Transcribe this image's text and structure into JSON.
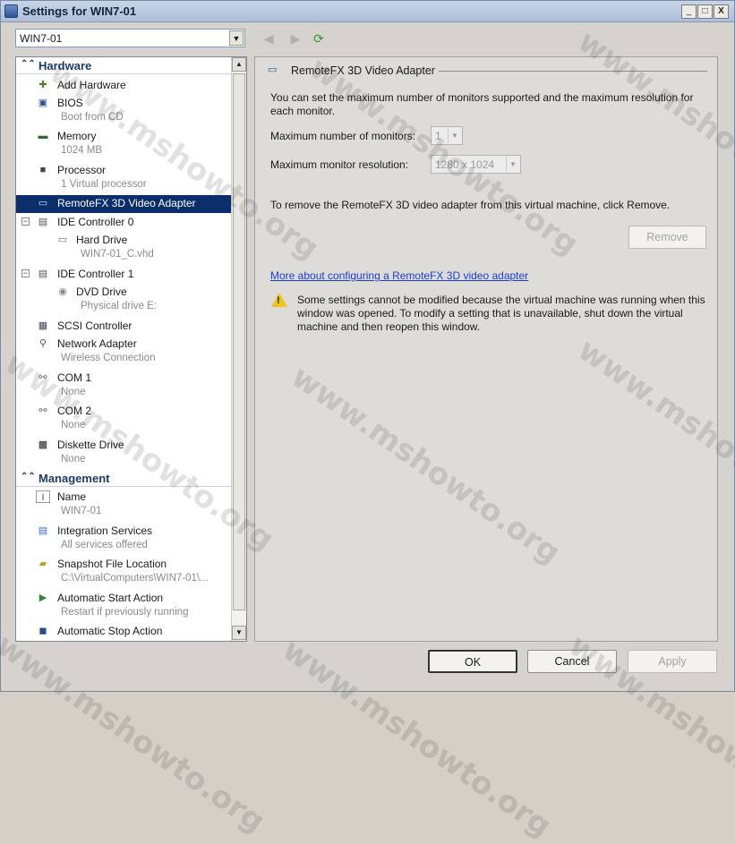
{
  "window": {
    "title": "Settings for WIN7-01",
    "minimize": "_",
    "restore": "□",
    "close": "X"
  },
  "vm_selector": {
    "value": "WIN7-01"
  },
  "hardware_section": {
    "label": "Hardware"
  },
  "management_section": {
    "label": "Management"
  },
  "hardware": {
    "add_hardware": "Add Hardware",
    "bios": {
      "label": "BIOS",
      "sub": "Boot from CD"
    },
    "memory": {
      "label": "Memory",
      "sub": "1024 MB"
    },
    "processor": {
      "label": "Processor",
      "sub": "1 Virtual processor"
    },
    "remotefx": {
      "label": "RemoteFX 3D Video Adapter"
    },
    "ide0": {
      "label": "IDE Controller 0"
    },
    "hard_drive": {
      "label": "Hard Drive",
      "sub": "WIN7-01_C.vhd"
    },
    "ide1": {
      "label": "IDE Controller 1"
    },
    "dvd_drive": {
      "label": "DVD Drive",
      "sub": "Physical drive E:"
    },
    "scsi": {
      "label": "SCSI Controller"
    },
    "network": {
      "label": "Network Adapter",
      "sub": "Wireless Connection"
    },
    "com1": {
      "label": "COM 1",
      "sub": "None"
    },
    "com2": {
      "label": "COM 2",
      "sub": "None"
    },
    "diskette": {
      "label": "Diskette Drive",
      "sub": "None"
    }
  },
  "management": {
    "name": {
      "label": "Name",
      "sub": "WIN7-01"
    },
    "integration": {
      "label": "Integration Services",
      "sub": "All services offered"
    },
    "snapshot": {
      "label": "Snapshot File Location",
      "sub": "C:\\VirtualComputers\\WIN7-01\\..."
    },
    "auto_start": {
      "label": "Automatic Start Action",
      "sub": "Restart if previously running"
    },
    "auto_stop": {
      "label": "Automatic Stop Action"
    }
  },
  "detail": {
    "group_title": "RemoteFX 3D Video Adapter",
    "description": "You can set the maximum number of monitors supported and the maximum resolution for each monitor.",
    "monitors_label": "Maximum number of monitors:",
    "monitors_value": "1",
    "resolution_label": "Maximum monitor resolution:",
    "resolution_value": "1280 x 1024",
    "remove_text": "To remove the RemoteFX 3D video adapter from this virtual machine, click Remove.",
    "remove_button": "Remove",
    "more_link": "More about configuring a RemoteFX 3D video adapter",
    "warning": "Some settings cannot be modified because the virtual machine was running when this window was opened. To modify a setting that is unavailable, shut down the virtual machine and then reopen this window."
  },
  "buttons": {
    "ok": "OK",
    "cancel": "Cancel",
    "apply": "Apply"
  },
  "watermark": "www.mshowto.org",
  "icons": [
    "window-icon",
    "back-icon",
    "forward-icon",
    "refresh-icon",
    "add-hardware-icon",
    "bios-icon",
    "memory-icon",
    "processor-icon",
    "monitor-icon",
    "ide-icon",
    "hard-drive-icon",
    "dvd-icon",
    "scsi-icon",
    "network-icon",
    "com-port-icon",
    "diskette-icon",
    "name-icon",
    "integration-icon",
    "snapshot-icon",
    "start-action-icon",
    "stop-action-icon",
    "warning-icon"
  ]
}
